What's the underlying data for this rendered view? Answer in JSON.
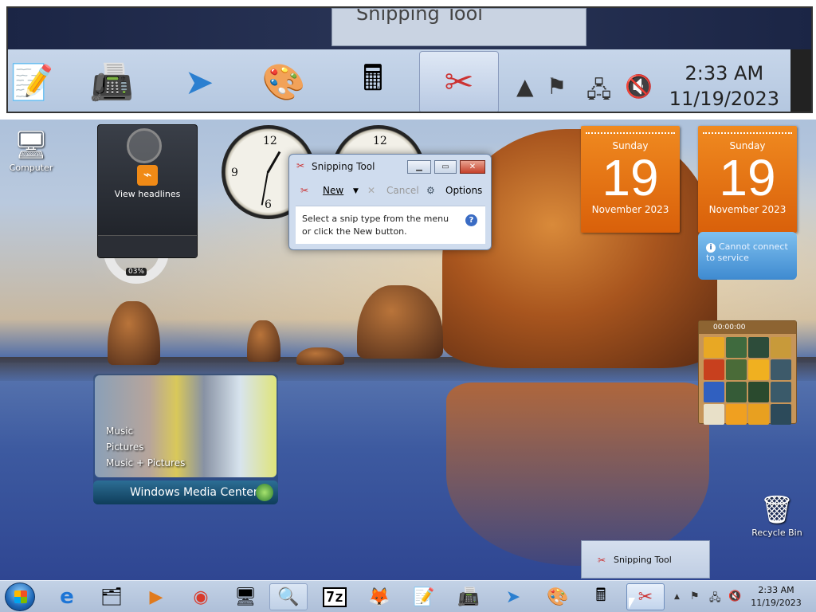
{
  "zoom_strip": {
    "popup_text": "Snipping Tool",
    "clock_time": "2:33 AM",
    "clock_date": "11/19/2023",
    "icons": [
      "notepad-icon",
      "printer-icon",
      "paper-plane-icon",
      "paint-palette-icon",
      "calculator-icon",
      "snipping-tool-icon"
    ],
    "tray_icons": [
      "show-hidden-icon",
      "action-center-icon",
      "network-icon",
      "volume-muted-icon"
    ]
  },
  "desktop": {
    "icons": [
      {
        "label": "Computer",
        "icon": "computer-icon"
      },
      {
        "label": "Recycle Bin",
        "icon": "recycle-bin-icon"
      }
    ]
  },
  "gadgets": {
    "feed_headlines": {
      "label": "View headlines"
    },
    "lifebuoy_meter": {
      "percent": "03%"
    },
    "calendars": [
      {
        "weekday": "Sunday",
        "day": "19",
        "month_year": "November 2023"
      },
      {
        "weekday": "Sunday",
        "day": "19",
        "month_year": "November 2023"
      }
    ],
    "weather_error": {
      "message": "Cannot connect to service"
    },
    "puzzle": {
      "timer": "00:00:00"
    },
    "media_center": {
      "menu": [
        "Music",
        "Pictures",
        "Music + Pictures"
      ],
      "brand": "Windows Media Center"
    }
  },
  "snipping_tool": {
    "title": "Snipping Tool",
    "toolbar": {
      "new": "New",
      "cancel": "Cancel",
      "options": "Options"
    },
    "message_line1": "Select a snip type from the menu",
    "message_line2": "or click the New button."
  },
  "taskbar_popup": {
    "label": "Snipping Tool"
  },
  "taskbar": {
    "clock_time": "2:33 AM",
    "clock_date": "11/19/2023",
    "pinned": [
      {
        "name": "internet-explorer-icon",
        "glyph": "e"
      },
      {
        "name": "file-explorer-icon",
        "glyph": "🗂"
      },
      {
        "name": "media-player-icon",
        "glyph": "▶"
      },
      {
        "name": "chrome-icon",
        "glyph": "◉"
      },
      {
        "name": "remote-desktop-icon",
        "glyph": "🖥"
      },
      {
        "name": "magnifier-icon",
        "glyph": "🔍"
      },
      {
        "name": "7zip-icon",
        "glyph": "7z"
      },
      {
        "name": "firefox-icon",
        "glyph": "🦊"
      },
      {
        "name": "notepad-icon",
        "glyph": "📝"
      },
      {
        "name": "fax-icon",
        "glyph": "📠"
      },
      {
        "name": "paper-plane-icon",
        "glyph": "➤"
      },
      {
        "name": "paint-icon",
        "glyph": "🎨"
      },
      {
        "name": "calculator-icon",
        "glyph": "🖩"
      },
      {
        "name": "snipping-tool-icon",
        "glyph": "✂"
      }
    ]
  },
  "colors": {
    "calendar_orange": "#e8741a",
    "taskbar_blue": "#b7c8e0",
    "rss_orange": "#f08a16"
  }
}
